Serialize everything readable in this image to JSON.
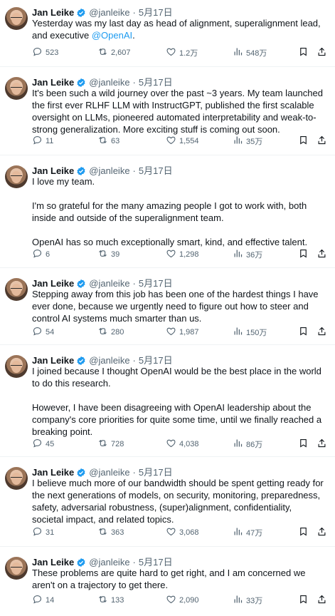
{
  "author": {
    "name": "Jan Leike",
    "handle": "@janleike",
    "separator": "·",
    "date": "5月17日"
  },
  "colors": {
    "accent": "#1d9bf0",
    "muted": "#536471",
    "text": "#0f1419"
  },
  "tweets": [
    {
      "paragraphs": [
        "Yesterday was my last day as head of alignment, superalignment lead, and executive "
      ],
      "mention": "@OpenAI",
      "mention_suffix": ".",
      "replies": "523",
      "retweets": "2,607",
      "likes": "1.2万",
      "views": "548万"
    },
    {
      "paragraphs": [
        "It's been such a wild journey over the past ~3 years. My team launched the first ever RLHF LLM with InstructGPT, published the first scalable oversight on LLMs, pioneered automated interpretability and weak-to-strong generalization. More exciting stuff is coming out soon."
      ],
      "replies": "11",
      "retweets": "63",
      "likes": "1,554",
      "views": "35万"
    },
    {
      "paragraphs": [
        "I love my team.",
        "I'm so grateful for the many amazing people I got to work with, both inside and outside of the superalignment team.",
        "OpenAI has so much exceptionally smart, kind, and effective talent."
      ],
      "replies": "6",
      "retweets": "39",
      "likes": "1,298",
      "views": "36万"
    },
    {
      "paragraphs": [
        "Stepping away from this job has been one of the hardest things I have ever done, because we urgently need to figure out how to steer and control AI systems much smarter than us."
      ],
      "replies": "54",
      "retweets": "280",
      "likes": "1,987",
      "views": "150万"
    },
    {
      "paragraphs": [
        "I joined because I thought OpenAI would be the best place in the world to do this research.",
        "However, I have been disagreeing with OpenAI leadership about the company's core priorities for quite some time, until we finally reached a breaking point."
      ],
      "replies": "45",
      "retweets": "728",
      "likes": "4,038",
      "views": "86万"
    },
    {
      "paragraphs": [
        "I believe much more of our bandwidth should be spent getting ready for the next generations of models, on security, monitoring, preparedness, safety, adversarial robustness, (super)alignment, confidentiality, societal impact, and related topics."
      ],
      "replies": "31",
      "retweets": "363",
      "likes": "3,068",
      "views": "47万"
    },
    {
      "paragraphs": [
        "These problems are quite hard to get right, and I am concerned we aren't on a trajectory to get there."
      ],
      "replies": "14",
      "retweets": "133",
      "likes": "2,090",
      "views": "33万"
    }
  ]
}
